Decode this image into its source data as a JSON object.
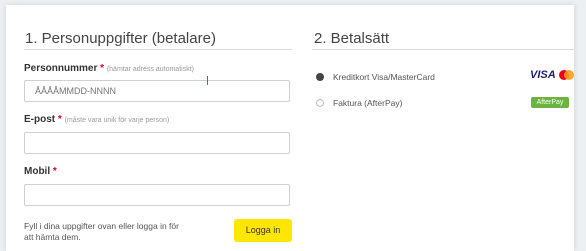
{
  "personal": {
    "title": "1. Personuppgifter (betalare)",
    "personnummer_label": "Personnummer",
    "personnummer_req": "*",
    "personnummer_hint": "(hämtar adress automatiskt)",
    "personnummer_placeholder": "ÅÅÅÅMMDD-NNNN",
    "email_label": "E-post",
    "email_req": "*",
    "email_hint": "(måste vara unik för varje person)",
    "email_value": "",
    "mobile_label": "Mobil",
    "mobile_req": "*",
    "mobile_value": "",
    "help_text": "Fyll i dina uppgifter ovan eller logga in för att hämta dem.",
    "login_button": "Logga in"
  },
  "payment": {
    "title": "2. Betalsätt",
    "options": [
      {
        "label": "Kreditkort Visa/MasterCard",
        "selected": true,
        "logo_text": "VISA"
      },
      {
        "label": "Faktura (AfterPay)",
        "selected": false,
        "logo_text": "AfterPay"
      }
    ]
  },
  "colors": {
    "accent_yellow": "#ffe600",
    "required_red": "#e2001a",
    "afterpay_green": "#6cb33f",
    "visa_blue": "#1a1f71"
  }
}
